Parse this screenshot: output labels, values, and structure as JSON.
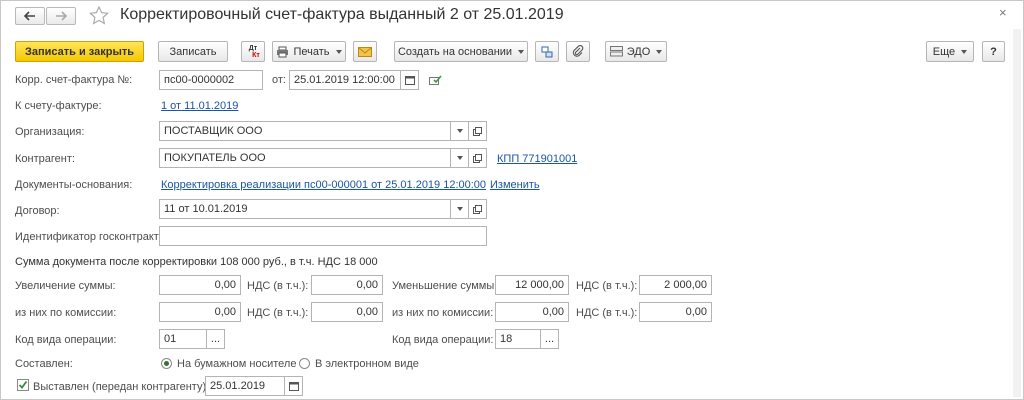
{
  "window": {
    "title": "Корректировочный счет-фактура выданный 2 от 25.01.2019",
    "close_label": "×"
  },
  "toolbar": {
    "save_close": "Записать и закрыть",
    "save": "Записать",
    "dtkt_top": "Дт",
    "dtkt_bottom": "Кт",
    "print": "Печать",
    "create_based": "Создать на основании",
    "edo": "ЭДО",
    "more": "Еще",
    "help": "?"
  },
  "form": {
    "corr_invoice": {
      "label": "Корр. счет-фактура №:",
      "number": "пс00-0000002",
      "date_label": "от:",
      "date": "25.01.2019 12:00:00"
    },
    "to_invoice": {
      "label": "К счету-фактуре:",
      "value": "1 от 11.01.2019"
    },
    "organization": {
      "label": "Организация:",
      "value": "ПОСТАВЩИК ООО"
    },
    "counterparty": {
      "label": "Контрагент:",
      "value": "ПОКУПАТЕЛЬ ООО",
      "kpp": "КПП 771901001"
    },
    "base_docs": {
      "label": "Документы-основания:",
      "value": "Корректировка реализации пс00-000001 от 25.01.2019 12:00:00",
      "change": "Изменить"
    },
    "contract": {
      "label": "Договор:",
      "value": "11 от 10.01.2019"
    },
    "gov_contract_id": {
      "label": "Идентификатор госконтракта:",
      "value": ""
    },
    "summary": "Сумма документа после корректировки 108 000 руб., в т.ч. НДС 18 000",
    "increase": {
      "label": "Увеличение суммы:",
      "value": "0,00",
      "vat_label": "НДС (в т.ч.):",
      "vat": "0,00"
    },
    "increase_commission": {
      "label": "из них по комиссии:",
      "value": "0,00",
      "vat_label": "НДС (в т.ч.):",
      "vat": "0,00"
    },
    "decrease": {
      "label": "Уменьшение суммы:",
      "value": "12 000,00",
      "vat_label": "НДС (в т.ч.):",
      "vat": "2 000,00"
    },
    "decrease_commission": {
      "label": "из них по комиссии:",
      "value": "0,00",
      "vat_label": "НДС (в т.ч.):",
      "vat": "0,00"
    },
    "op_code_left": {
      "label": "Код вида операции:",
      "value": "01"
    },
    "op_code_right": {
      "label": "Код вида операции:",
      "value": "18"
    },
    "ellipsis": "...",
    "composed": {
      "label": "Составлен:",
      "paper": "На бумажном носителе",
      "electronic": "В электронном виде",
      "selected": "paper"
    },
    "issued": {
      "label": "Выставлен (передан контрагенту):",
      "checked": true,
      "date": "25.01.2019"
    }
  },
  "colors": {
    "primary_button": "#f5c800",
    "link": "#1a55a6",
    "border": "#b4b4b4"
  }
}
